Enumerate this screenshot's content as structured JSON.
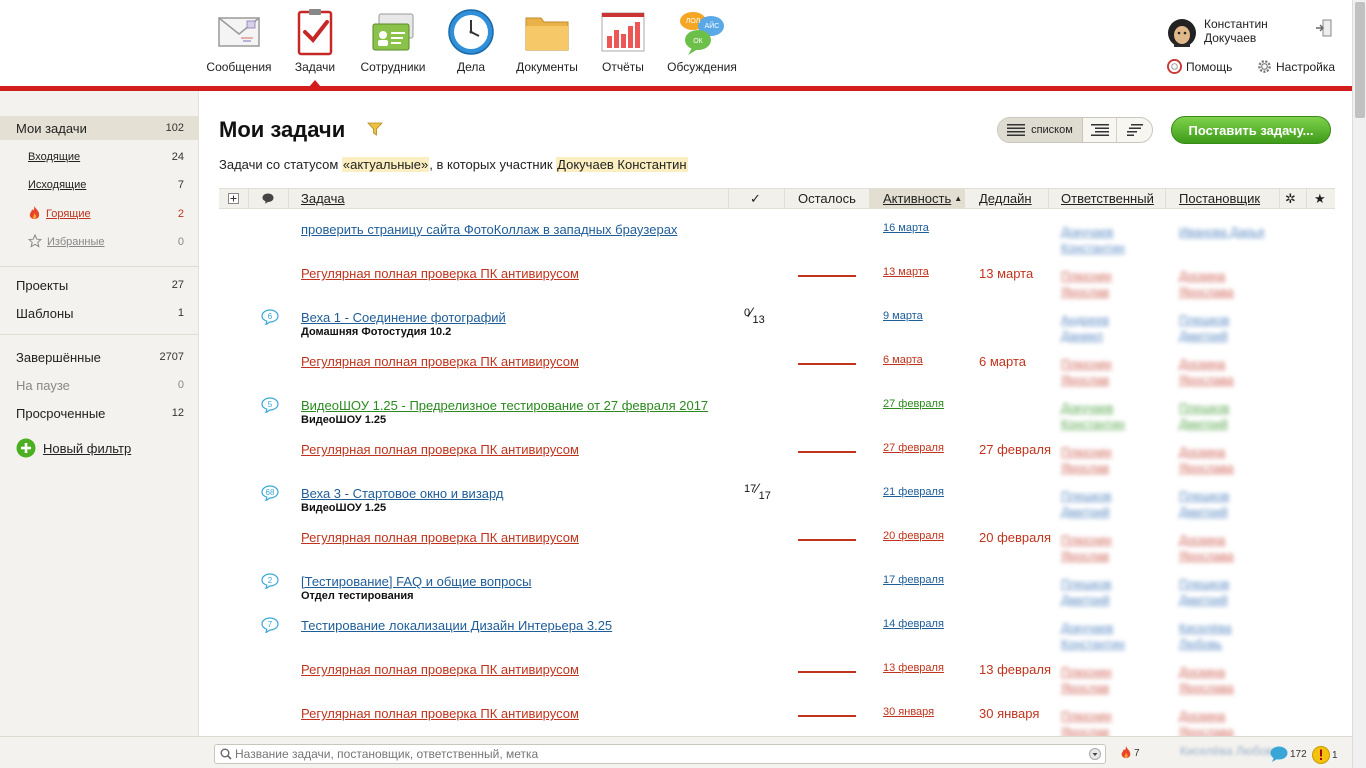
{
  "nav": [
    {
      "label": "Сообщения",
      "icon": "envelope-icon"
    },
    {
      "label": "Задачи",
      "icon": "clipboard-check-icon",
      "active": true
    },
    {
      "label": "Сотрудники",
      "icon": "id-cards-icon"
    },
    {
      "label": "Дела",
      "icon": "clock-icon"
    },
    {
      "label": "Документы",
      "icon": "folder-icon"
    },
    {
      "label": "Отчёты",
      "icon": "bar-chart-icon"
    },
    {
      "label": "Обсуждения",
      "icon": "speech-bubbles-icon"
    }
  ],
  "nav_icon_text": {
    "lol": "ЛОЛ",
    "ais": "АЙС",
    "ok": "ОК"
  },
  "user": {
    "first_name": "Константин",
    "last_name": "Докучаев"
  },
  "toplinks": {
    "help": "Помощь",
    "settings": "Настройка"
  },
  "sidebar": {
    "my_tasks": {
      "label": "Мои задачи",
      "count": "102"
    },
    "incoming": {
      "label": "Входящие",
      "count": "24"
    },
    "outgoing": {
      "label": "Исходящие",
      "count": "7"
    },
    "hot": {
      "label": "Горящие",
      "count": "2"
    },
    "favorites": {
      "label": "Избранные",
      "count": "0"
    },
    "projects": {
      "label": "Проекты",
      "count": "27"
    },
    "templates": {
      "label": "Шаблоны",
      "count": "1"
    },
    "completed": {
      "label": "Завершённые",
      "count": "2707"
    },
    "paused": {
      "label": "На паузе",
      "count": "0"
    },
    "overdue": {
      "label": "Просроченные",
      "count": "12"
    },
    "new_filter": "Новый фильтр"
  },
  "main": {
    "title": "Мои задачи",
    "subtitle_prefix": "Задачи со статусом ",
    "subtitle_status": "«актуальные»",
    "subtitle_mid": ", в которых участник ",
    "subtitle_person": "Докучаев Константин",
    "view_list_label": "списком",
    "add_task_label": "Поставить задачу..."
  },
  "table": {
    "headers": {
      "task": "Задача",
      "check": "✓",
      "left": "Осталось",
      "activity": "Активность",
      "deadline": "Дедлайн",
      "responsible": "Ответственный",
      "author": "Постановщик",
      "settings": "✲",
      "star": "★"
    },
    "rows": [
      {
        "title": "проверить страницу сайта ФотоКоллаж в западных браузерах",
        "color": "blue",
        "activity": "16 марта",
        "resp": "Докучаев Константин",
        "auth": "Иванова Дарья",
        "resp_color": "blue",
        "auth_color": "blue"
      },
      {
        "title": "Регулярная полная проверка ПК антивирусом",
        "color": "red",
        "left_bar": true,
        "activity": "13 марта",
        "deadline": "13 марта",
        "resp": "Плюснин Ярослав",
        "auth": "Доскина Ярослава",
        "resp_color": "red",
        "auth_color": "red"
      },
      {
        "title": "Веха 1 - Соединение фотографий",
        "color": "blue",
        "project": "Домашняя Фотостудия 10.2",
        "comments": "6",
        "check_done": "0",
        "check_total": "13",
        "activity": "9 марта",
        "resp": "Андреев Даниил",
        "auth": "Плешков Дмитрий",
        "resp_color": "blue",
        "auth_color": "blue"
      },
      {
        "title": "Регулярная полная проверка ПК антивирусом",
        "color": "red",
        "left_bar": true,
        "activity": "6 марта",
        "deadline": "6 марта",
        "resp": "Плюснин Ярослав",
        "auth": "Доскина Ярослава",
        "resp_color": "red",
        "auth_color": "red"
      },
      {
        "title": "ВидеоШОУ 1.25 - Предрелизное тестирование от 27 февраля 2017",
        "color": "green",
        "project": "ВидеоШОУ 1.25",
        "comments": "5",
        "activity": "27 февраля",
        "resp": "Докучаев Константин",
        "auth": "Плешков Дмитрий",
        "resp_color": "green",
        "auth_color": "green"
      },
      {
        "title": "Регулярная полная проверка ПК антивирусом",
        "color": "red",
        "left_bar": true,
        "activity": "27 февраля",
        "deadline": "27 февраля",
        "resp": "Плюснин Ярослав",
        "auth": "Доскина Ярослава",
        "resp_color": "red",
        "auth_color": "red"
      },
      {
        "title": "Веха 3 - Стартовое окно и визард",
        "color": "blue",
        "project": "ВидеоШОУ 1.25",
        "comments": "68",
        "check_done": "17",
        "check_total": "17",
        "activity": "21 февраля",
        "resp": "Плешков Дмитрий",
        "auth": "Плешков Дмитрий",
        "resp_color": "blue",
        "auth_color": "blue"
      },
      {
        "title": "Регулярная полная проверка ПК антивирусом",
        "color": "red",
        "left_bar": true,
        "activity": "20 февраля",
        "deadline": "20 февраля",
        "resp": "Плюснин Ярослав",
        "auth": "Доскина Ярослава",
        "resp_color": "red",
        "auth_color": "red"
      },
      {
        "title": "[Тестирование] FAQ и общие вопросы",
        "color": "blue",
        "project": "Отдел тестирования",
        "comments": "2",
        "activity": "17 февраля",
        "resp": "Плешков Дмитрий",
        "auth": "Плешков Дмитрий",
        "resp_color": "blue",
        "auth_color": "blue"
      },
      {
        "title": "Тестирование локализации Дизайн Интерьера 3.25",
        "color": "blue",
        "comments": "7",
        "activity": "14 февраля",
        "resp": "Докучаев Константин",
        "auth": "Киселёва Любовь",
        "resp_color": "blue",
        "auth_color": "blue"
      },
      {
        "title": "Регулярная полная проверка ПК антивирусом",
        "color": "red",
        "left_bar": true,
        "activity": "13 февраля",
        "deadline": "13 февраля",
        "resp": "Плюснин Ярослав",
        "auth": "Доскина Ярослава",
        "resp_color": "red",
        "auth_color": "red"
      },
      {
        "title": "Регулярная полная проверка ПК антивирусом",
        "color": "red",
        "left_bar": true,
        "activity": "30 января",
        "deadline": "30 января",
        "resp": "Плюснин Ярослав",
        "auth": "Доскина Ярослава",
        "resp_color": "red",
        "auth_color": "red"
      }
    ]
  },
  "footer": {
    "search_placeholder": "Название задачи, постановщик, ответственный, метка",
    "hot_count": "7",
    "blurred_name": "Киселёва Любовь",
    "comments_count": "172",
    "alerts_count": "1"
  },
  "colors": {
    "accent_red": "#d21d1d",
    "link_blue": "#1f5d99",
    "task_red": "#c0341d",
    "task_green": "#2a8a1e",
    "button_green": "#4caf22"
  }
}
